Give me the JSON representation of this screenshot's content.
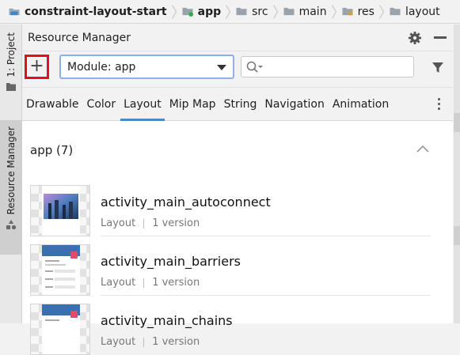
{
  "breadcrumb": {
    "items": [
      {
        "label": "constraint-layout-start",
        "icon": "project-icon"
      },
      {
        "label": "app",
        "icon": "module-folder-icon"
      },
      {
        "label": "src",
        "icon": "folder-icon"
      },
      {
        "label": "main",
        "icon": "folder-icon"
      },
      {
        "label": "res",
        "icon": "res-folder-icon"
      },
      {
        "label": "layout",
        "icon": "folder-icon"
      }
    ]
  },
  "left_tool_windows": {
    "project_label": "1: Project",
    "resource_manager_label": "Resource Manager"
  },
  "panel": {
    "title": "Resource Manager",
    "add_label": "+",
    "module_select": "Module: app",
    "search_placeholder": ""
  },
  "tabs": [
    "Drawable",
    "Color",
    "Layout",
    "Mip Map",
    "String",
    "Navigation",
    "Animation"
  ],
  "active_tab": "Layout",
  "section": {
    "title": "app (7)"
  },
  "resources": [
    {
      "name": "activity_main_autoconnect",
      "type": "Layout",
      "versions": "1 version"
    },
    {
      "name": "activity_main_barriers",
      "type": "Layout",
      "versions": "1 version"
    },
    {
      "name": "activity_main_chains",
      "type": "Layout",
      "versions": "1 version"
    }
  ],
  "colors": {
    "accent": "#4a88c7",
    "highlight": "#e0101e",
    "focus": "#8ab2e8"
  }
}
